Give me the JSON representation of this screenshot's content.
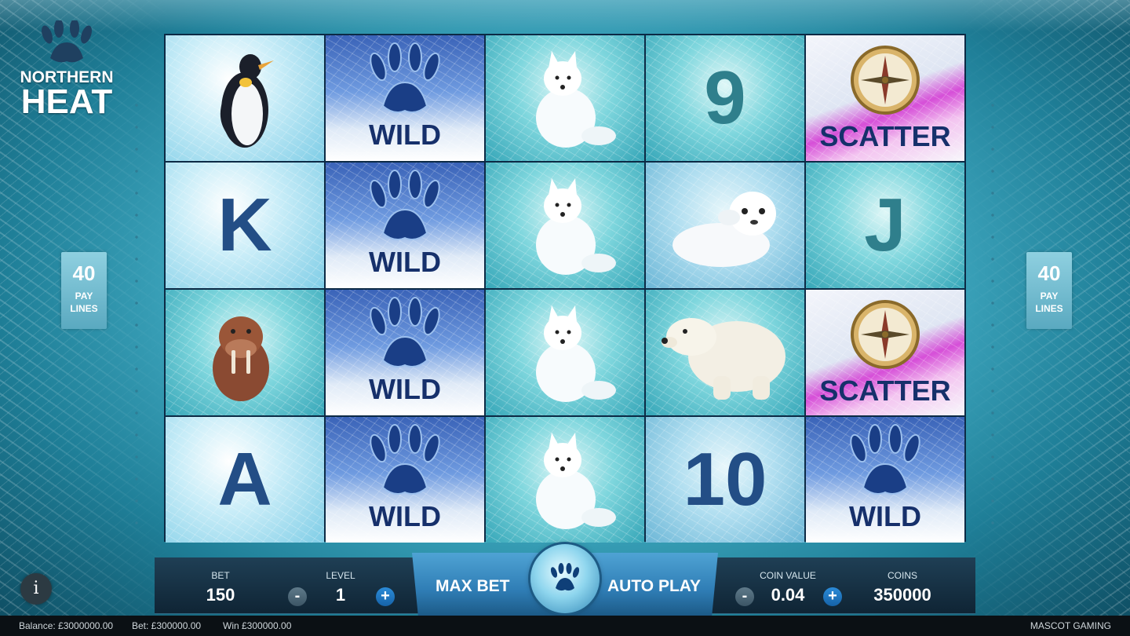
{
  "logo": {
    "line1": "NORTHERN",
    "line2": "HEAT"
  },
  "paylines": {
    "left": {
      "count": "40",
      "label": "PAY LINES"
    },
    "right": {
      "count": "40",
      "label": "PAY LINES"
    }
  },
  "reels": [
    [
      "penguin",
      "wild",
      "arctic-fox",
      "9",
      "scatter"
    ],
    [
      "K",
      "wild",
      "arctic-fox",
      "seal-pup",
      "J"
    ],
    [
      "walrus",
      "wild",
      "arctic-fox",
      "polar-bear",
      "scatter"
    ],
    [
      "A",
      "wild",
      "arctic-fox",
      "10",
      "wild"
    ]
  ],
  "symbols": {
    "wild_label": "WILD",
    "scatter_label": "SCATTER",
    "nine": "9",
    "ten": "10",
    "k": "K",
    "j": "J",
    "a": "A"
  },
  "controls": {
    "bet": {
      "caption": "BET",
      "value": "150"
    },
    "level": {
      "caption": "LEVEL",
      "value": "1"
    },
    "max_bet": "MAX BET",
    "auto_play": "AUTO PLAY",
    "coin_value": {
      "caption": "COIN VALUE",
      "value": "0.04"
    },
    "coins": {
      "caption": "COINS",
      "value": "350000"
    },
    "minus": "-",
    "plus": "+",
    "info": "i"
  },
  "status_bar": {
    "balance": "Balance: £3000000.00",
    "bet": "Bet: £300000.00",
    "win": "Win £300000.00",
    "brand": "MASCOT GAMING"
  },
  "colors": {
    "accent": "#1663a8",
    "wild_text": "#16306b",
    "letter": "#234e86"
  }
}
